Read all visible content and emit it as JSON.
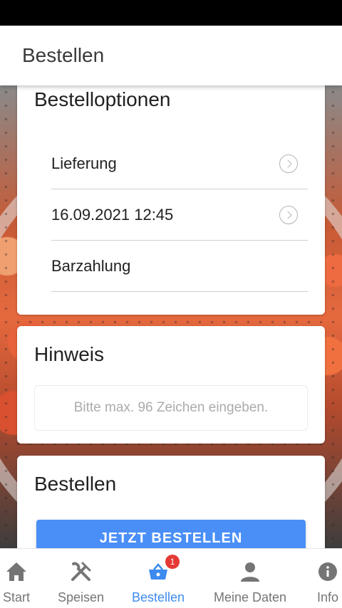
{
  "app_bar": {
    "title": "Bestellen"
  },
  "options_card": {
    "title": "Bestelloptionen",
    "rows": [
      {
        "label": "Lieferung",
        "has_chevron": true
      },
      {
        "label": "16.09.2021 12:45",
        "has_chevron": true
      },
      {
        "label": "Barzahlung",
        "has_chevron": false
      }
    ]
  },
  "hint_card": {
    "title": "Hinweis",
    "placeholder": "Bitte max. 96 Zeichen eingeben."
  },
  "order_card": {
    "title": "Bestellen",
    "button_label": "JETZT BESTELLEN"
  },
  "bottom_nav": {
    "items": [
      {
        "label": "Start",
        "icon": "home-icon"
      },
      {
        "label": "Speisen",
        "icon": "cutlery-icon"
      },
      {
        "label": "Bestellen",
        "icon": "basket-icon",
        "active": true,
        "badge": "1"
      },
      {
        "label": "Meine Daten",
        "icon": "person-icon"
      },
      {
        "label": "Info",
        "icon": "info-icon"
      }
    ]
  },
  "colors": {
    "accent": "#3d8bee",
    "button": "#4a8ff7",
    "badge": "#e53935"
  }
}
